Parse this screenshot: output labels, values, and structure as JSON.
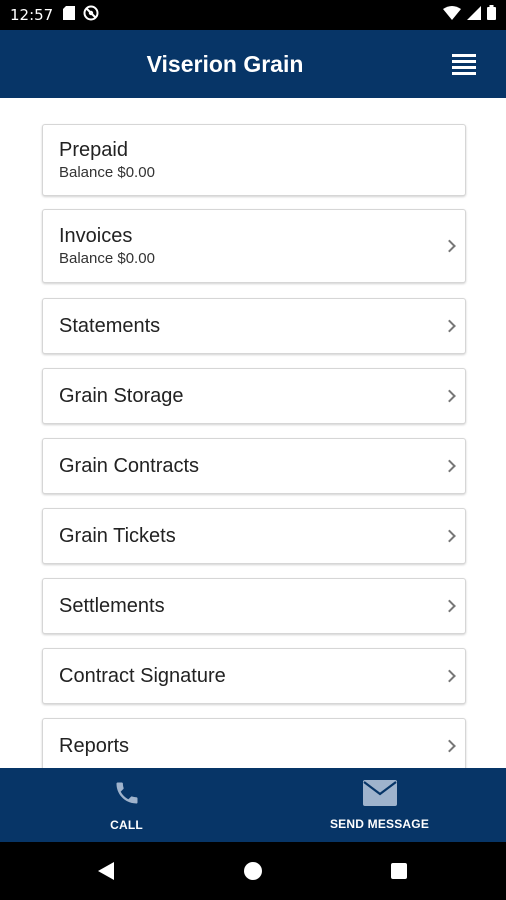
{
  "status_bar": {
    "time": "12:57",
    "left_icons": [
      "sd-card-icon",
      "do-not-disturb-icon"
    ],
    "right_icons": [
      "wifi-icon",
      "signal-icon",
      "battery-icon"
    ]
  },
  "header": {
    "title": "Viserion Grain",
    "menu_icon": "hamburger-menu-icon",
    "background": "#073567"
  },
  "menu_items": [
    {
      "label": "Prepaid",
      "sub": "Balance $0.00",
      "chevron": false
    },
    {
      "label": "Invoices",
      "sub": "Balance $0.00",
      "chevron": true
    },
    {
      "label": "Statements",
      "sub": "",
      "chevron": true
    },
    {
      "label": "Grain Storage",
      "sub": "",
      "chevron": true
    },
    {
      "label": "Grain Contracts",
      "sub": "",
      "chevron": true
    },
    {
      "label": "Grain Tickets",
      "sub": "",
      "chevron": true
    },
    {
      "label": "Settlements",
      "sub": "",
      "chevron": true
    },
    {
      "label": "Contract Signature",
      "sub": "",
      "chevron": true
    },
    {
      "label": "Reports",
      "sub": "",
      "chevron": true
    }
  ],
  "bottom_bar": {
    "call_label": "CALL",
    "call_icon": "phone-icon",
    "message_label": "SEND MESSAGE",
    "message_icon": "envelope-icon"
  },
  "nav_bar": {
    "icons": [
      "back-icon",
      "home-icon",
      "recents-icon"
    ]
  }
}
